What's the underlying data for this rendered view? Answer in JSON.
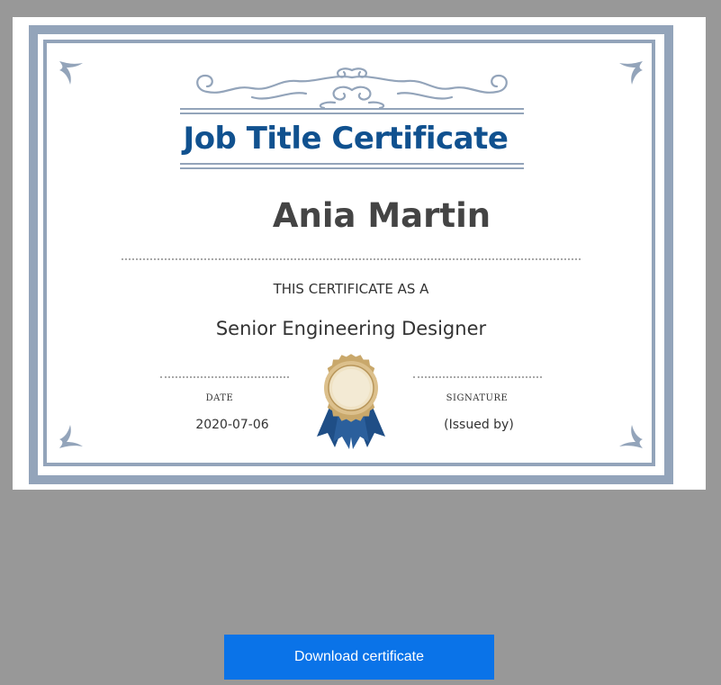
{
  "certificate": {
    "title": "Job Title Certificate",
    "recipient_name": "Ania Martin",
    "statement": "THIS CERTIFICATE AS A",
    "job_title": "Senior Engineering Designer",
    "date_label": "DATE",
    "date_value": "2020-07-06",
    "signature_label": "SIGNATURE",
    "signature_value": "(Issued by)",
    "colors": {
      "frame": "#93a4ba",
      "title": "#10518f",
      "ribbon": "#1f4e86",
      "medal": "#c9a86b"
    }
  },
  "actions": {
    "download_label": "Download certificate"
  },
  "colors": {
    "background": "#989898",
    "button": "#0a73e8"
  }
}
